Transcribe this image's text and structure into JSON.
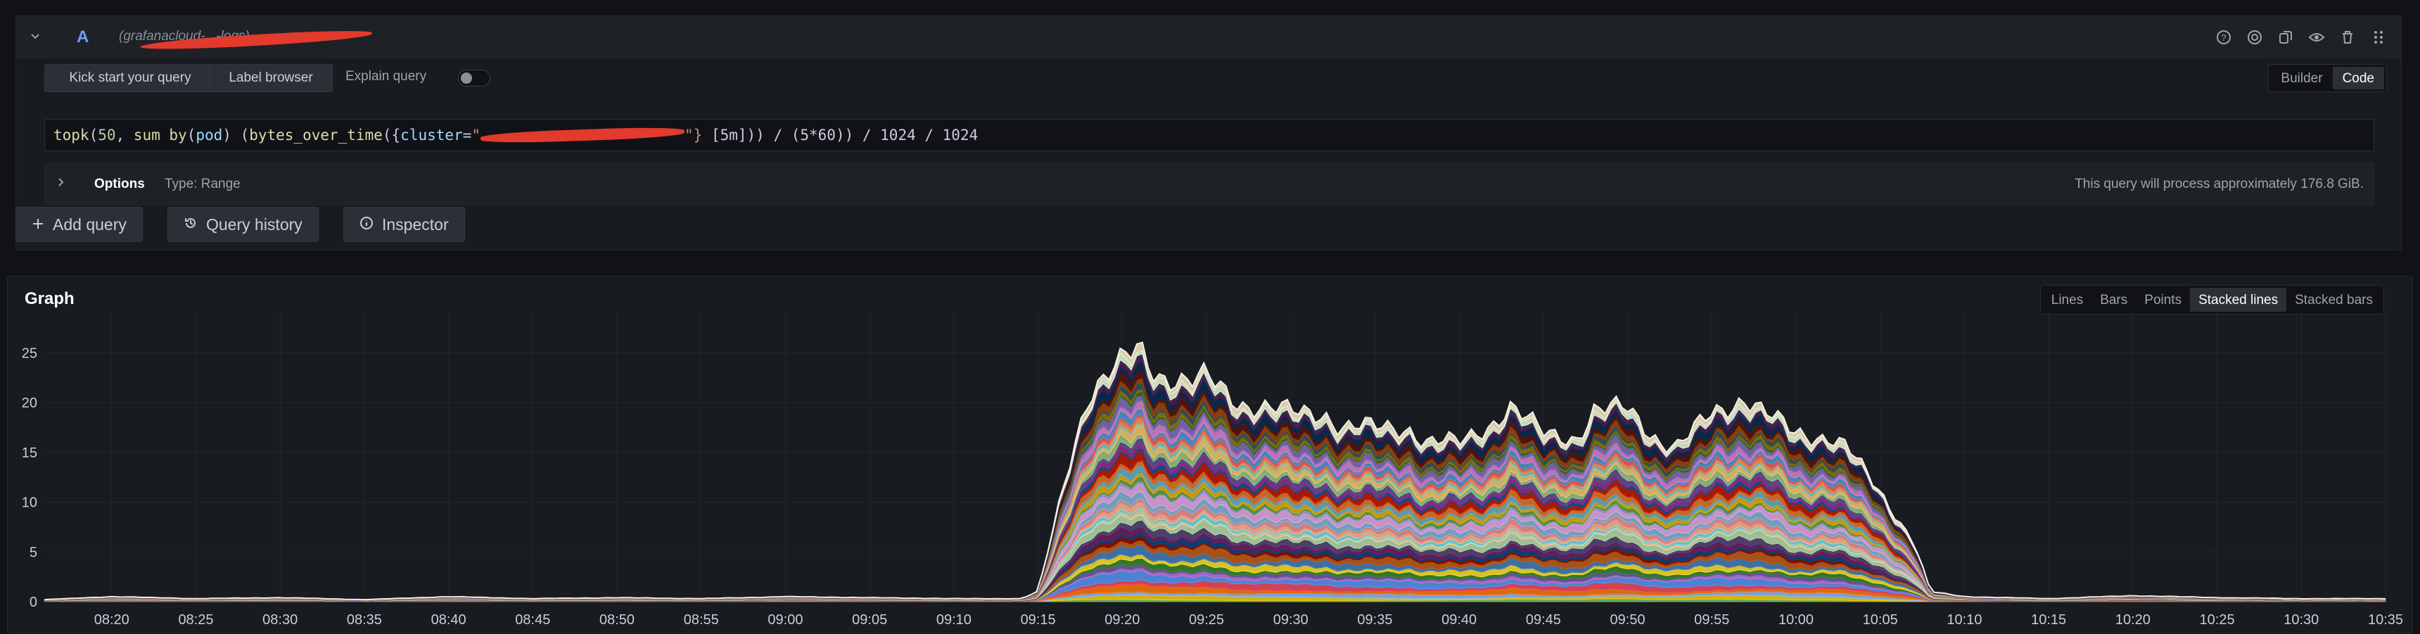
{
  "query": {
    "ref_id": "A",
    "datasource": "(grafanacloud-...-logs)",
    "kickstart_label": "Kick start your query",
    "label_browser_label": "Label browser",
    "explain_label": "Explain query",
    "explain_enabled": false,
    "mode_builder": "Builder",
    "mode_code": "Code",
    "active_mode": "Code",
    "code": {
      "p1": "topk",
      "p2": "(",
      "p3": "50",
      "p4": ", ",
      "p5": "sum by",
      "p6": "(",
      "p7": "pod",
      "p8": ") (",
      "p9": "bytes_over_time",
      "p10": "({",
      "p11": "cluster",
      "p12": "=",
      "p13": "\"",
      "p14": "\"}",
      "p15": " [5m])) / (5*60)) / 1024 / 1024"
    },
    "options_label": "Options",
    "options_type": "Type: Range",
    "process_info": "This query will process approximately 176.8 GiB."
  },
  "actions": {
    "add_query": "Add query",
    "query_history": "Query history",
    "inspector": "Inspector"
  },
  "graph": {
    "title": "Graph",
    "viz_options": [
      "Lines",
      "Bars",
      "Points",
      "Stacked lines",
      "Stacked bars"
    ],
    "active_viz": "Stacked lines"
  },
  "header_icons": [
    "help-icon",
    "target-icon",
    "copy-icon",
    "eye-icon",
    "trash-icon",
    "drag-icon"
  ],
  "chart_data": {
    "type": "area",
    "stacked": true,
    "series_count": 50,
    "ylim": [
      0,
      27
    ],
    "yticks": [
      0,
      5,
      10,
      15,
      20,
      25
    ],
    "xticks": [
      "08:20",
      "08:25",
      "08:30",
      "08:35",
      "08:40",
      "08:45",
      "08:50",
      "08:55",
      "09:00",
      "09:05",
      "09:10",
      "09:15",
      "09:20",
      "09:25",
      "09:30",
      "09:35",
      "09:40",
      "09:45",
      "09:50",
      "09:55",
      "10:00",
      "10:05",
      "10:10",
      "10:15",
      "10:20",
      "10:25",
      "10:30",
      "10:35"
    ],
    "x": [
      "08:16",
      "08:20",
      "08:25",
      "08:30",
      "08:35",
      "08:40",
      "08:45",
      "08:50",
      "08:55",
      "09:00",
      "09:05",
      "09:10",
      "09:14",
      "09:15",
      "09:16",
      "09:17",
      "09:18",
      "09:20",
      "09:21",
      "09:22",
      "09:24",
      "09:25",
      "09:27",
      "09:30",
      "09:32",
      "09:33",
      "09:35",
      "09:37",
      "09:38",
      "09:40",
      "09:42",
      "09:43",
      "09:45",
      "09:47",
      "09:48",
      "09:50",
      "09:52",
      "09:53",
      "09:55",
      "09:57",
      "09:58",
      "10:00",
      "10:02",
      "10:03",
      "10:05",
      "10:07",
      "10:08",
      "10:10",
      "10:15",
      "10:20",
      "10:25",
      "10:30",
      "10:35"
    ],
    "total": [
      0.2,
      0.5,
      0.3,
      0.4,
      0.2,
      0.5,
      0.3,
      0.4,
      0.3,
      0.5,
      0.4,
      0.3,
      0.3,
      1,
      8,
      15,
      21,
      24,
      25.5,
      23,
      22,
      22.5,
      20,
      19,
      19,
      17.5,
      17.5,
      17.5,
      16,
      16,
      18,
      19.5,
      17,
      16.5,
      19,
      19.5,
      16,
      15.5,
      19,
      20.5,
      19,
      17,
      16.5,
      15.5,
      11,
      6,
      1,
      0.5,
      0.3,
      0.6,
      0.4,
      0.3,
      0.3
    ],
    "colors": [
      "#73bf69",
      "#f2cc0c",
      "#8ab8ff",
      "#ff780a",
      "#f2495c",
      "#5794f2",
      "#b877d9",
      "#705da0",
      "#37872d",
      "#fade2a",
      "#447ebc",
      "#c15c17",
      "#890f02",
      "#0a437c",
      "#6d1f62",
      "#584477",
      "#b7dbab",
      "#f4d598",
      "#70dbed",
      "#f9ba8f",
      "#f29191",
      "#82b5d8",
      "#e5a8e2",
      "#aea2e0",
      "#629e51",
      "#e5ac0e",
      "#64b0c8",
      "#e0752d",
      "#bf1b00",
      "#0a50a1",
      "#962d82",
      "#614d93",
      "#9ac48a",
      "#f2c96d",
      "#65c5db",
      "#f9934e",
      "#ea6460",
      "#5195ce",
      "#d683ce",
      "#806eb7",
      "#3f6833",
      "#967302",
      "#2f575e",
      "#99440a",
      "#58140c",
      "#052b51",
      "#511749",
      "#3f2b5b",
      "#e0f9d7",
      "#fceaca"
    ]
  }
}
